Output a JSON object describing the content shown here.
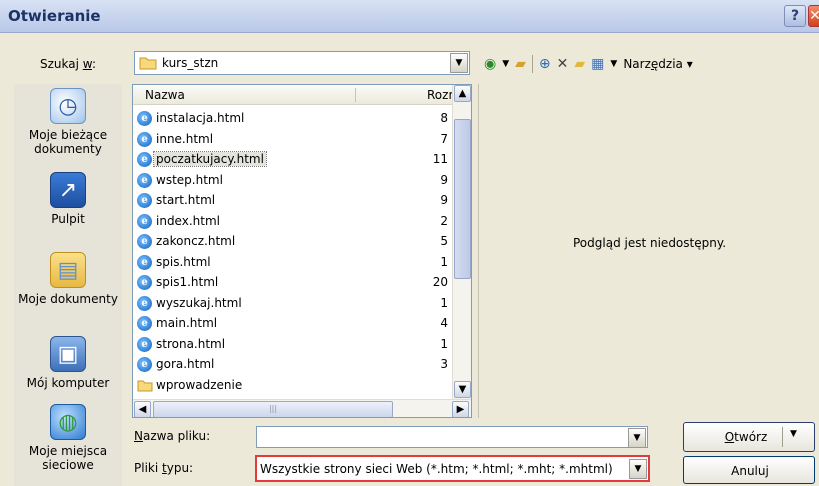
{
  "window": {
    "title": "Otwieranie",
    "help_glyph": "?",
    "close_glyph": "✕"
  },
  "lookin": {
    "label_pre": "Szukaj ",
    "label_accel": "w",
    "label_post": ":",
    "value": "kurs_stzn"
  },
  "toolbar": {
    "tools_label_pre": "Narz",
    "tools_label_accel": "ę",
    "tools_label_post": "dzia"
  },
  "places": [
    {
      "label": "Moje bieżące dokumenty",
      "icon": "recent-documents-icon"
    },
    {
      "label": "Pulpit",
      "icon": "desktop-icon"
    },
    {
      "label": "Moje dokumenty",
      "icon": "my-documents-icon"
    },
    {
      "label": "Mój komputer",
      "icon": "my-computer-icon"
    },
    {
      "label": "Moje miejsca sieciowe",
      "icon": "network-places-icon"
    }
  ],
  "filelist": {
    "col_name": "Nazwa",
    "col_size": "Rozm",
    "rows": [
      {
        "name": "instalacja.html",
        "size": "8",
        "type": "html"
      },
      {
        "name": "inne.html",
        "size": "7",
        "type": "html"
      },
      {
        "name": "poczatkujacy.html",
        "size": "11",
        "type": "html",
        "selected": true
      },
      {
        "name": "wstep.html",
        "size": "9",
        "type": "html"
      },
      {
        "name": "start.html",
        "size": "9",
        "type": "html"
      },
      {
        "name": "index.html",
        "size": "2",
        "type": "html"
      },
      {
        "name": "zakoncz.html",
        "size": "5",
        "type": "html"
      },
      {
        "name": "spis.html",
        "size": "1",
        "type": "html"
      },
      {
        "name": "spis1.html",
        "size": "20",
        "type": "html"
      },
      {
        "name": "wyszukaj.html",
        "size": "1",
        "type": "html"
      },
      {
        "name": "main.html",
        "size": "4",
        "type": "html"
      },
      {
        "name": "strona.html",
        "size": "1",
        "type": "html"
      },
      {
        "name": "gora.html",
        "size": "3",
        "type": "html"
      },
      {
        "name": "wprowadzenie",
        "size": "",
        "type": "folder"
      }
    ]
  },
  "preview": {
    "message": "Podgląd jest niedostępny."
  },
  "bottom": {
    "filename_label_accel": "N",
    "filename_label_rest": "azwa pliku:",
    "filename_value": "",
    "filetype_label_pre": "Pliki ",
    "filetype_label_accel": "t",
    "filetype_label_post": "ypu:",
    "filetype_value": "Wszystkie strony sieci Web (*.htm; *.html; *.mht; *.mhtml)",
    "open_accel": "O",
    "open_rest": "twórz",
    "cancel_label": "Anuluj"
  },
  "colors": {
    "highlight_border": "#e33b3b",
    "title_text": "#1c3266"
  }
}
